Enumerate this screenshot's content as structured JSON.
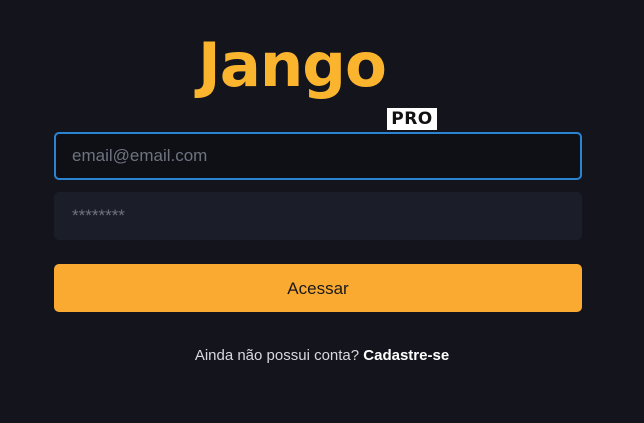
{
  "logo": {
    "word": "Jango",
    "badge": "PRO"
  },
  "login_form": {
    "email_placeholder": "email@email.com",
    "password_placeholder": "********",
    "submit_label": "Acessar"
  },
  "signup": {
    "prompt": "Ainda não possui conta?",
    "link_label": "Cadastre-se"
  },
  "colors": {
    "background": "#13141c",
    "accent": "#fbaa31",
    "focus_border": "#2b84d1"
  }
}
